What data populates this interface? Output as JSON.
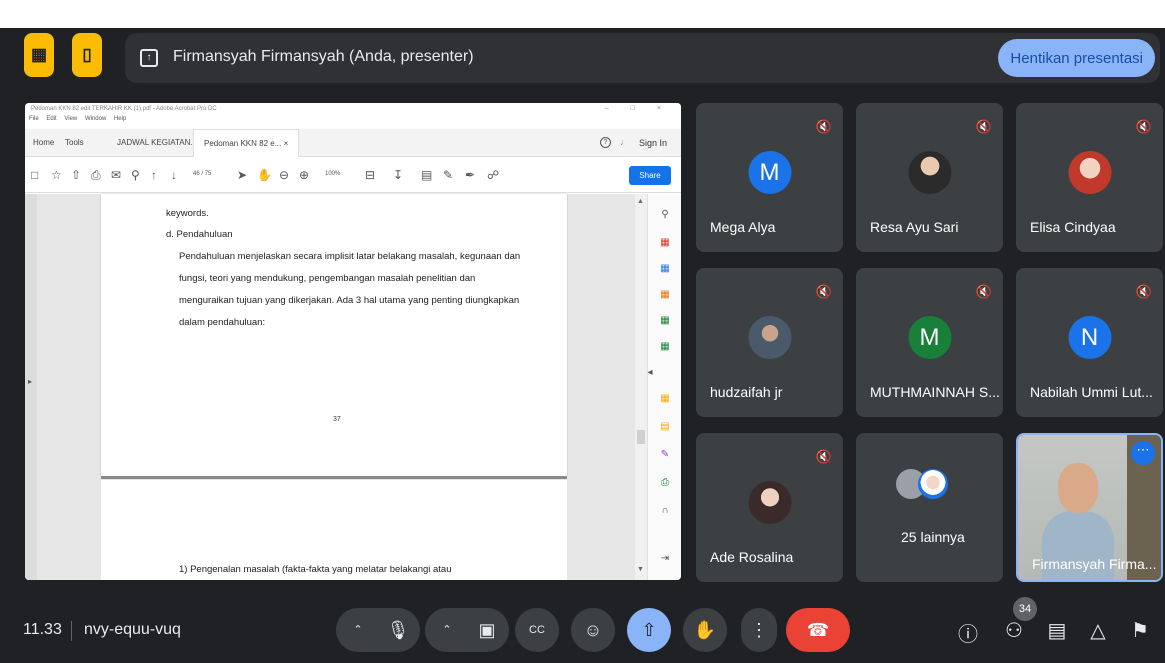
{
  "header": {
    "presenter_name": "Firmansyah Firmansyah (Anda, presenter)",
    "stop_button": "Hentikan presentasi"
  },
  "shared_window": {
    "title": "Pedoman KKN 82 edit TERKAHIR KK (1).pdf - Adobe Acrobat Pro DC",
    "menu": [
      "File",
      "Edit",
      "View",
      "Window",
      "Help"
    ],
    "tabs": [
      "Home",
      "Tools",
      "JADWAL KEGIATAN...",
      "Pedoman KKN 82 e... ×"
    ],
    "sign_in": "Sign In",
    "page_indicator": "46 / 75",
    "zoom": "100%",
    "share_button": "Share",
    "doc_lines": [
      "keywords.",
      "d. Pendahuluan",
      "Pendahuluan menjelaskan secara implisit latar belakang masalah, kegunaan dan",
      "fungsi,   teori   yang   mendukung,   pengembangan   masalah   penelitian   dan",
      "menguraikan tujuan yang dikerjakan. Ada 3 hal utama yang penting diungkapkan",
      "dalam pendahuluan:"
    ],
    "page_number": "37",
    "page2_line": "1) Pengenalan     masalah     (fakta-fakta     yang     melatar     belakangi     atau"
  },
  "participants": [
    {
      "name": "Mega Alya",
      "initial": "M",
      "color": "#1a73e8",
      "photo": false
    },
    {
      "name": "Resa Ayu Sari",
      "initial": "",
      "color": "#3c4043",
      "photo": true
    },
    {
      "name": "Elisa Cindyaa",
      "initial": "",
      "color": "#3c4043",
      "photo": true
    },
    {
      "name": "hudzaifah jr",
      "initial": "",
      "color": "#3c4043",
      "photo": true
    },
    {
      "name": "MUTHMAINNAH S...",
      "initial": "M",
      "color": "#188038",
      "photo": false
    },
    {
      "name": "Nabilah Ummi Lut...",
      "initial": "N",
      "color": "#1a73e8",
      "photo": false
    },
    {
      "name": "Ade Rosalina",
      "initial": "",
      "color": "#3c4043",
      "photo": true
    }
  ],
  "others_label": "25 lainnya",
  "self_name": "Firmansyah Firma...",
  "bottom": {
    "time": "11.33",
    "meeting_code": "nvy-equu-vuq",
    "participant_count": "34"
  },
  "icons": {
    "mic": "microphone-icon",
    "camera": "camera-icon",
    "captions": "captions-icon",
    "emoji": "emoji-icon",
    "present": "present-screen-icon",
    "hand": "raise-hand-icon",
    "more": "more-options-icon",
    "end_call": "end-call-icon",
    "info": "info-icon",
    "people": "people-icon",
    "chat": "chat-icon",
    "activities": "activities-icon",
    "host_controls": "host-controls-icon"
  }
}
